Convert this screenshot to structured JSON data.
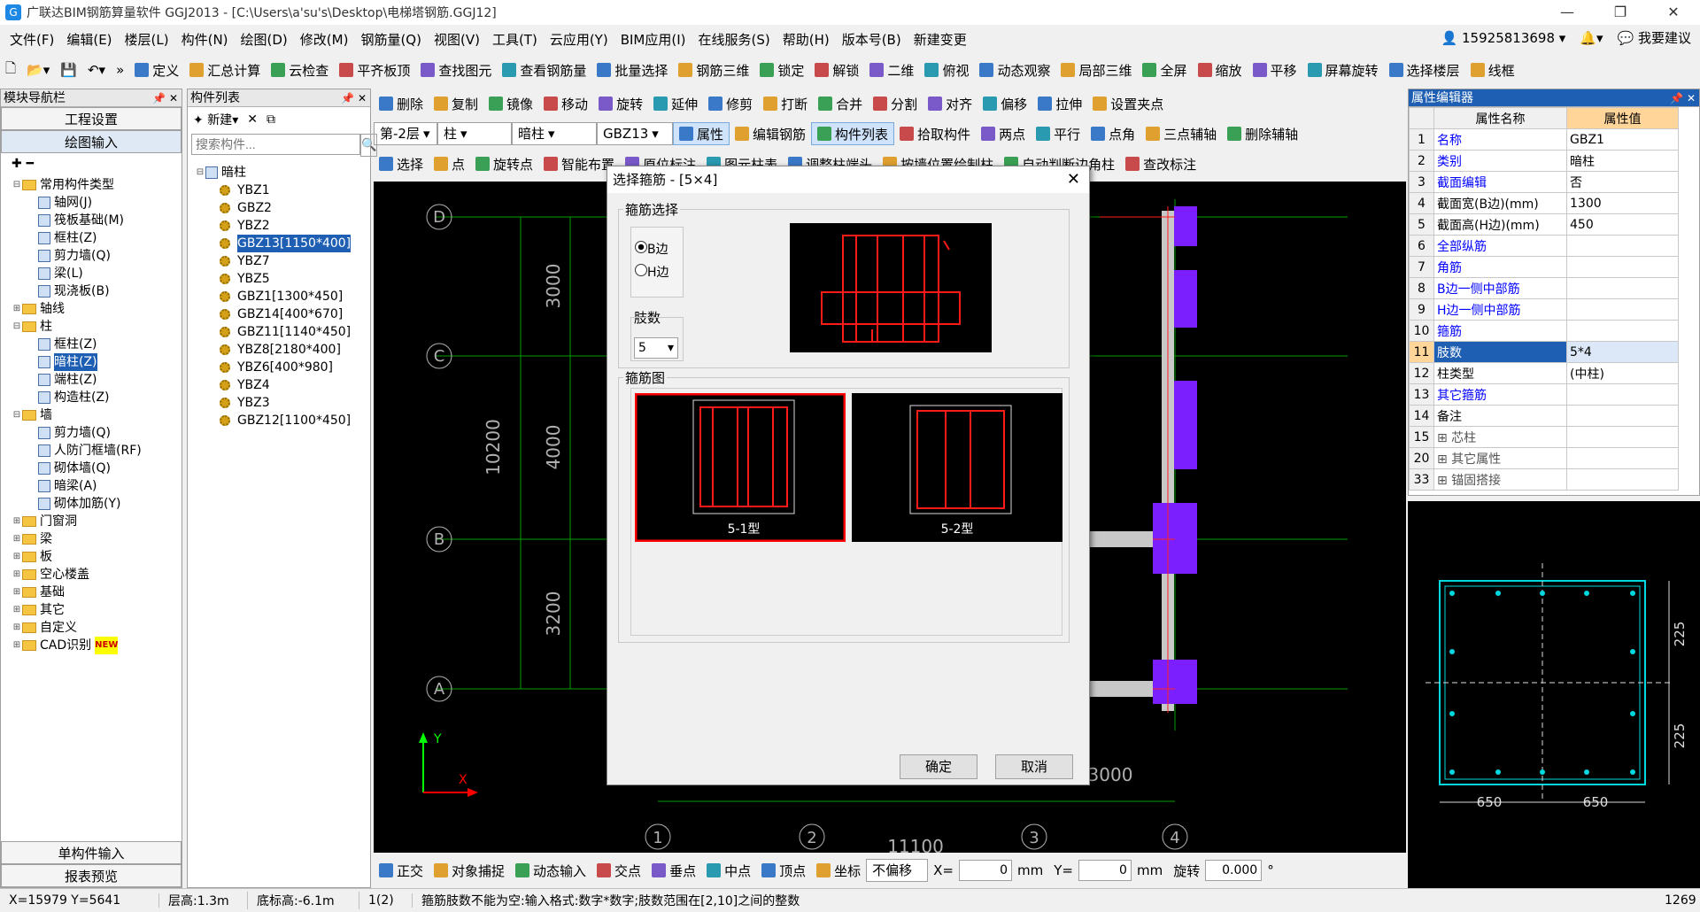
{
  "window": {
    "title": "广联达BIM钢筋算量软件 GGJ2013 - [C:\\Users\\a'su's\\Desktop\\电梯塔钢筋.GGJ12]",
    "app_icon": "G"
  },
  "menu": [
    "文件(F)",
    "编辑(E)",
    "楼层(L)",
    "构件(N)",
    "绘图(D)",
    "修改(M)",
    "钢筋量(Q)",
    "视图(V)",
    "工具(T)",
    "云应用(Y)",
    "BIM应用(I)",
    "在线服务(S)",
    "帮助(H)",
    "版本号(B)",
    "新建变更"
  ],
  "menu_right": {
    "phone": "15925813698",
    "suggest": "我要建议"
  },
  "toolbar1": [
    "定义",
    "汇总计算",
    "云检查",
    "平齐板顶",
    "查找图元",
    "查看钢筋量",
    "批量选择",
    "钢筋三维",
    "锁定",
    "解锁",
    "二维",
    "俯视",
    "动态观察",
    "局部三维",
    "全屏",
    "缩放",
    "平移",
    "屏幕旋转",
    "选择楼层",
    "线框"
  ],
  "toolbar2": [
    "删除",
    "复制",
    "镜像",
    "移动",
    "旋转",
    "延伸",
    "修剪",
    "打断",
    "合并",
    "分割",
    "对齐",
    "偏移",
    "拉伸",
    "设置夹点"
  ],
  "toolbar3": {
    "floor": "第-2层",
    "type": "柱",
    "subtype": "暗柱",
    "element": "GBZ13",
    "buttons": [
      "属性",
      "编辑钢筋",
      "构件列表",
      "拾取构件",
      "两点",
      "平行",
      "点角",
      "三点辅轴",
      "删除辅轴"
    ]
  },
  "toolbar4": [
    "选择",
    "点",
    "旋转点",
    "智能布置",
    "原位标注",
    "图元柱表",
    "调整柱端头",
    "按墙位置绘制柱",
    "自动判断边角柱",
    "查改标注"
  ],
  "nav": {
    "title": "模块导航栏",
    "btn_project": "工程设置",
    "btn_draw": "绘图输入",
    "btn_single": "单构件输入",
    "btn_report": "报表预览",
    "tree": [
      {
        "level": 0,
        "exp": "⊟",
        "type": "folder",
        "label": "常用构件类型"
      },
      {
        "level": 1,
        "type": "ticon",
        "label": "轴网(J)"
      },
      {
        "level": 1,
        "type": "ticon",
        "label": "筏板基础(M)"
      },
      {
        "level": 1,
        "type": "ticon",
        "label": "框柱(Z)"
      },
      {
        "level": 1,
        "type": "ticon",
        "label": "剪力墙(Q)"
      },
      {
        "level": 1,
        "type": "ticon",
        "label": "梁(L)"
      },
      {
        "level": 1,
        "type": "ticon",
        "label": "现浇板(B)"
      },
      {
        "level": 0,
        "exp": "⊞",
        "type": "folder",
        "label": "轴线"
      },
      {
        "level": 0,
        "exp": "⊟",
        "type": "folder",
        "label": "柱"
      },
      {
        "level": 1,
        "type": "ticon",
        "label": "框柱(Z)"
      },
      {
        "level": 1,
        "type": "ticon",
        "label": "暗柱(Z)",
        "sel": true
      },
      {
        "level": 1,
        "type": "ticon",
        "label": "端柱(Z)"
      },
      {
        "level": 1,
        "type": "ticon",
        "label": "构造柱(Z)"
      },
      {
        "level": 0,
        "exp": "⊟",
        "type": "folder",
        "label": "墙"
      },
      {
        "level": 1,
        "type": "ticon",
        "label": "剪力墙(Q)"
      },
      {
        "level": 1,
        "type": "ticon",
        "label": "人防门框墙(RF)"
      },
      {
        "level": 1,
        "type": "ticon",
        "label": "砌体墙(Q)"
      },
      {
        "level": 1,
        "type": "ticon",
        "label": "暗梁(A)"
      },
      {
        "level": 1,
        "type": "ticon",
        "label": "砌体加筋(Y)"
      },
      {
        "level": 0,
        "exp": "⊞",
        "type": "folder",
        "label": "门窗洞"
      },
      {
        "level": 0,
        "exp": "⊞",
        "type": "folder",
        "label": "梁"
      },
      {
        "level": 0,
        "exp": "⊞",
        "type": "folder",
        "label": "板"
      },
      {
        "level": 0,
        "exp": "⊞",
        "type": "folder",
        "label": "空心楼盖"
      },
      {
        "level": 0,
        "exp": "⊞",
        "type": "folder",
        "label": "基础"
      },
      {
        "level": 0,
        "exp": "⊞",
        "type": "folder",
        "label": "其它"
      },
      {
        "level": 0,
        "exp": "⊞",
        "type": "folder",
        "label": "自定义"
      },
      {
        "level": 0,
        "exp": "⊞",
        "type": "folder",
        "label": "CAD识别",
        "badge": "NEW"
      }
    ]
  },
  "comp_list": {
    "title": "构件列表",
    "new": "新建",
    "search_placeholder": "搜索构件...",
    "root": "暗柱",
    "items": [
      "YBZ1",
      "GBZ2",
      "YBZ2",
      "GBZ13[1150*400]",
      "YBZ7",
      "YBZ5",
      "GBZ1[1300*450]",
      "GBZ14[400*670]",
      "GBZ11[1140*450]",
      "YBZ8[2180*400]",
      "YBZ6[400*980]",
      "YBZ4",
      "YBZ3",
      "GBZ12[1100*450]"
    ],
    "selected_index": 3
  },
  "dialog": {
    "title": "选择箍筋 - [5×4]",
    "group_select": "箍筋选择",
    "radio_b": "B边",
    "radio_h": "H边",
    "group_count": "肢数",
    "count_value": "5",
    "group_fig": "箍筋图",
    "fig1": "5-1型",
    "fig2": "5-2型",
    "ok": "确定",
    "cancel": "取消"
  },
  "props": {
    "title": "属性编辑器",
    "col_name": "属性名称",
    "col_val": "属性值",
    "rows": [
      {
        "n": "1",
        "name": "名称",
        "val": "GBZ1",
        "blue": true
      },
      {
        "n": "2",
        "name": "类别",
        "val": "暗柱",
        "blue": true
      },
      {
        "n": "3",
        "name": "截面编辑",
        "val": "否",
        "blue": true
      },
      {
        "n": "4",
        "name": "截面宽(B边)(mm)",
        "val": "1300"
      },
      {
        "n": "5",
        "name": "截面高(H边)(mm)",
        "val": "450"
      },
      {
        "n": "6",
        "name": "全部纵筋",
        "val": "",
        "blue": true
      },
      {
        "n": "7",
        "name": "角筋",
        "val": "",
        "blue": true
      },
      {
        "n": "8",
        "name": "B边一侧中部筋",
        "val": "",
        "blue": true
      },
      {
        "n": "9",
        "name": "H边一侧中部筋",
        "val": "",
        "blue": true
      },
      {
        "n": "10",
        "name": "箍筋",
        "val": "",
        "blue": true
      },
      {
        "n": "11",
        "name": "肢数",
        "val": "5*4",
        "sel": true
      },
      {
        "n": "12",
        "name": "柱类型",
        "val": "(中柱)"
      },
      {
        "n": "13",
        "name": "其它箍筋",
        "val": "",
        "blue": true
      },
      {
        "n": "14",
        "name": "备注",
        "val": ""
      },
      {
        "n": "15",
        "name": "⊞ 芯柱",
        "val": "",
        "gray": true
      },
      {
        "n": "20",
        "name": "⊞ 其它属性",
        "val": "",
        "gray": true
      },
      {
        "n": "33",
        "name": "⊞ 锚固搭接",
        "val": "",
        "gray": true
      }
    ]
  },
  "preview": {
    "dim_h1": "225",
    "dim_h2": "225",
    "dim_w1": "650",
    "dim_w2": "650"
  },
  "canvas": {
    "axes_left": [
      "D",
      "C",
      "B",
      "A"
    ],
    "axes_bottom": [
      "1",
      "2",
      "3",
      "4"
    ],
    "dims_v": [
      "3000",
      "4000",
      "3200"
    ],
    "total_v": "10200",
    "dim_bottom": "11100",
    "dim_right": "3000",
    "axis_y": "Y",
    "axis_x": "X"
  },
  "bottom_tb": {
    "buttons": [
      "正交",
      "对象捕捉",
      "动态输入",
      "交点",
      "垂点",
      "中点",
      "顶点",
      "坐标"
    ],
    "offset": "不偏移",
    "x_label": "X=",
    "x_val": "0",
    "mm1": "mm",
    "y_label": "Y=",
    "y_val": "0",
    "mm2": "mm",
    "rot": "旋转",
    "rot_val": "0.000",
    "deg": "°"
  },
  "status": {
    "coords": "X=15979 Y=5641",
    "floor_h": "层高:1.3m",
    "base_h": "底标高:-6.1m",
    "count": "1(2)",
    "hint": "箍筋肢数不能为空:输入格式:数字*数字;肢数范围在[2,10]之间的整数",
    "right": "1269"
  }
}
